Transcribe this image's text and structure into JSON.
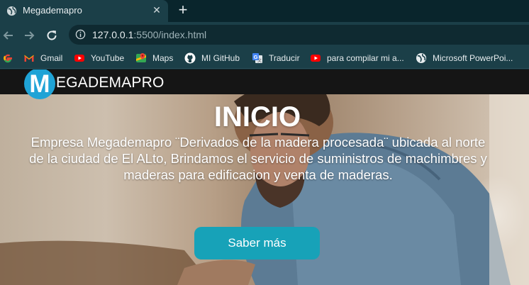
{
  "browser": {
    "tab": {
      "title": "Megademapro",
      "close_icon": "close-icon",
      "favicon": "globe-icon"
    },
    "new_tab_icon": "plus-icon",
    "toolbar": {
      "back_icon": "arrow-left-icon",
      "forward_icon": "arrow-right-icon",
      "reload_icon": "reload-icon",
      "url_host": "127.0.0.1",
      "url_rest": ":5500/index.html"
    },
    "bookmarks": [
      {
        "label": "",
        "icon": "google-icon"
      },
      {
        "label": "Gmail",
        "icon": "gmail-icon"
      },
      {
        "label": "YouTube",
        "icon": "youtube-icon"
      },
      {
        "label": "Maps",
        "icon": "maps-icon"
      },
      {
        "label": "MI GitHub",
        "icon": "github-icon"
      },
      {
        "label": "Traducir",
        "icon": "translate-icon"
      },
      {
        "label": "para compilar mi a...",
        "icon": "youtube-icon"
      },
      {
        "label": "Microsoft PowerPoi...",
        "icon": "globe-icon"
      }
    ]
  },
  "site": {
    "logo_letter": "M",
    "brand_name": "EGADEMAPRO",
    "hero": {
      "title": "INICIO",
      "description": "Empresa Megademapro ¨Derivados de la madera procesada¨ ubicada al norte de la ciudad de El ALto, Brindamos el servicio de suministros de machimbres y maderas para edificacion y venta de maderas.",
      "button_label": "Saber más"
    }
  },
  "colors": {
    "chrome_dark": "#09252c",
    "chrome": "#1b3f48",
    "navbar": "#151515",
    "logo_circle": "#1fa3d6",
    "button": "#17a2b8"
  }
}
